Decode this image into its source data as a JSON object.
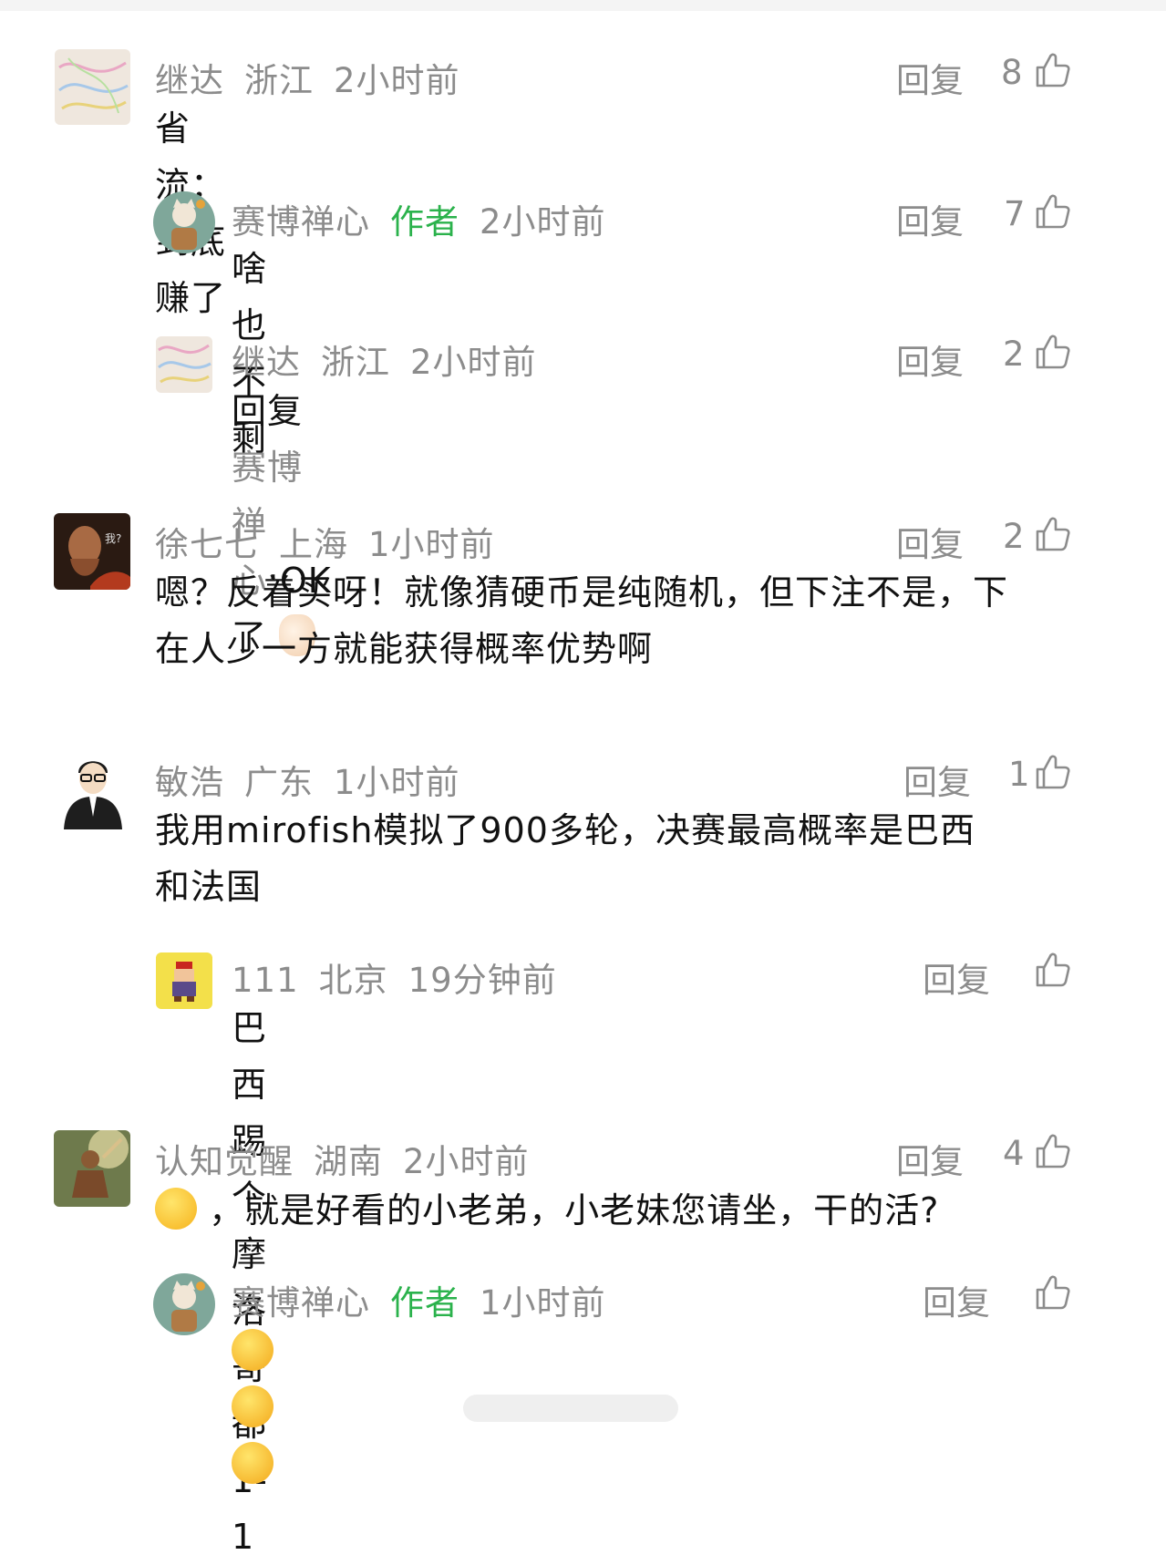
{
  "labels": {
    "reply": "回复",
    "author_tag": "作者"
  },
  "comments": [
    {
      "name": "继达",
      "location": "浙江",
      "time": "2小时前",
      "likes": "8",
      "text": "省流：到底赚了没?"
    },
    {
      "name": "赛博禅心",
      "time": "2小时前",
      "likes": "7",
      "text": "啥也不剩"
    },
    {
      "name": "继达",
      "location": "浙江",
      "time": "2小时前",
      "likes": "2",
      "reply_prefix": "回复",
      "reply_to": "赛博禅心",
      "text": ":OK了"
    },
    {
      "name": "徐七七",
      "location": "上海",
      "time": "1小时前",
      "likes": "2",
      "avatar_text": "我?",
      "text_line1": "嗯？反着买呀！就像猜硬币是纯随机，但下注不是，下",
      "text_line2": "在人少一方就能获得概率优势啊"
    },
    {
      "name": "敏浩",
      "location": "广东",
      "time": "1小时前",
      "likes": "1",
      "text_line1": "我用mirofish模拟了900多轮，决赛最高概率是巴西",
      "text_line2": "和法国"
    },
    {
      "name": "111",
      "location": "北京",
      "time": "19分钟前",
      "likes": "",
      "text": "巴西踢个摩洛哥都1-1"
    },
    {
      "name": "认知觉醒",
      "location": "湖南",
      "time": "2小时前",
      "likes": "4",
      "text": "，就是好看的小老弟，小老妹您请坐，干的活?"
    },
    {
      "name": "赛博禅心",
      "time": "1小时前",
      "likes": "",
      "text": ""
    }
  ],
  "colors": {
    "meta": "#8c8c8c",
    "author": "#2bb24c",
    "text": "#111111"
  },
  "icons": [
    "thumbs-up-icon",
    "grinning-emoji",
    "ok-hand-emoji",
    "shy-smile-emoji"
  ]
}
